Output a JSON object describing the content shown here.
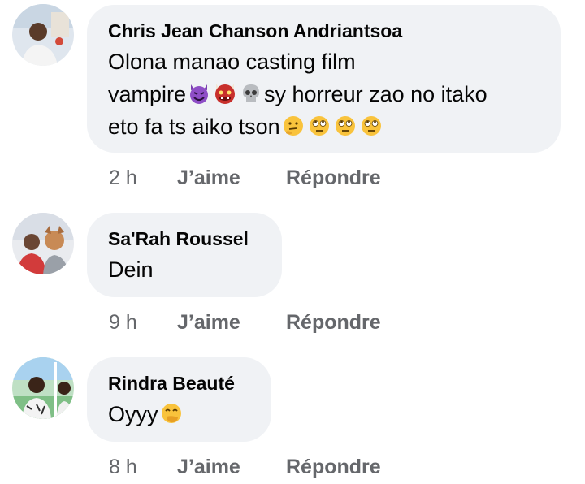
{
  "comments": [
    {
      "author": "Chris Jean Chanson Andriantsoa",
      "text_parts": [
        "Olona manao casting film",
        "vampire",
        "sy horreur zao no itako",
        "eto fa ts aiko tson"
      ],
      "emojis_line2": [
        "smiling-face-with-horns-icon",
        "ogre-icon",
        "skull-icon"
      ],
      "emojis_line3": [
        "thinking-face-icon",
        "face-with-rolling-eyes-icon",
        "face-with-rolling-eyes-icon",
        "face-with-rolling-eyes-icon"
      ],
      "time": "2 h",
      "like": "J’aime",
      "reply": "Répondre"
    },
    {
      "author": "Sa'Rah Roussel",
      "text": "Dein",
      "time": "9 h",
      "like": "J’aime",
      "reply": "Répondre"
    },
    {
      "author": "Rindra Beauté",
      "text": "Oyyy",
      "emojis": [
        "face-with-hand-over-mouth-icon"
      ],
      "time": "8 h",
      "like": "J’aime",
      "reply": "Répondre"
    }
  ],
  "colors": {
    "bubble_bg": "#f0f2f5",
    "meta_text": "#65676b",
    "primary_text": "#050505"
  }
}
